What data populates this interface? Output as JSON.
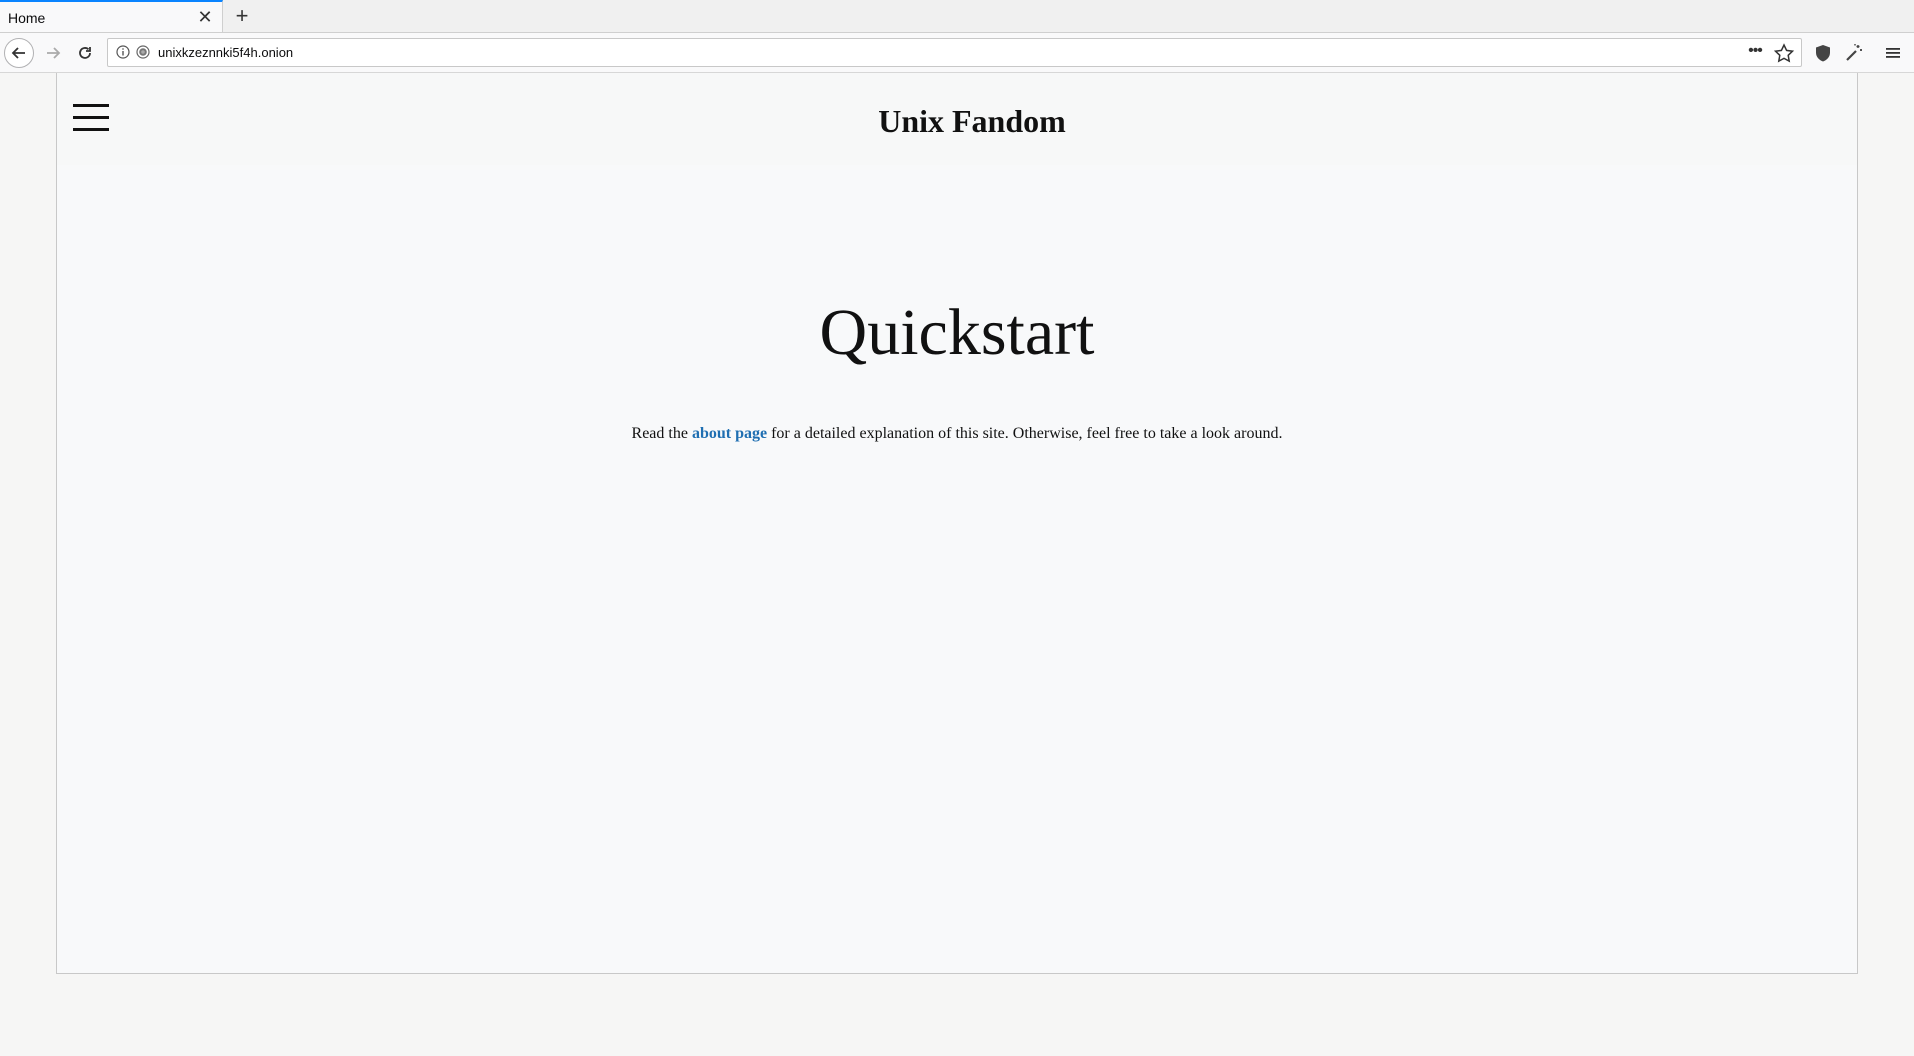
{
  "browser": {
    "tab_title": "Home",
    "url": "unixkzeznnki5f4h.onion"
  },
  "site": {
    "title": "Unix Fandom"
  },
  "main": {
    "heading": "Quickstart",
    "intro_before": "Read the ",
    "intro_link": "about page",
    "intro_after": " for a detailed explanation of this site. Otherwise, feel free to take a look around."
  },
  "colors": {
    "link": "#1f6fb2",
    "active_tab_accent": "#0a84ff"
  }
}
